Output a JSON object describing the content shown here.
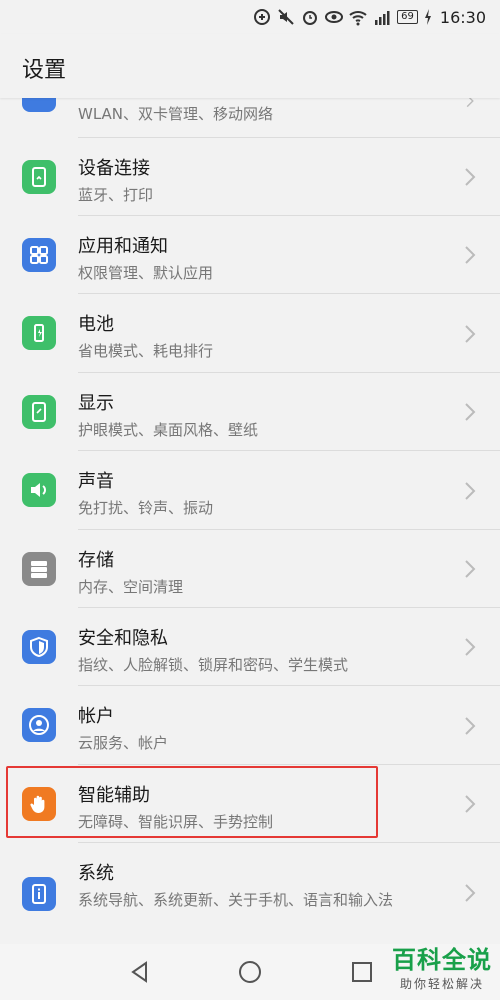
{
  "status_bar": {
    "icons": [
      "data-saver-icon",
      "mute-icon",
      "alarm-icon",
      "eye-comfort-icon",
      "wifi-icon",
      "signal-4g-icon"
    ],
    "battery": "69",
    "time": "16:30"
  },
  "header": {
    "title": "设置"
  },
  "partial_item": {
    "subtitle": "WLAN、双卡管理、移动网络"
  },
  "items": [
    {
      "title": "设备连接",
      "subtitle": "蓝牙、打印",
      "icon": "device-connection-icon",
      "color": "#3fbf6a"
    },
    {
      "title": "应用和通知",
      "subtitle": "权限管理、默认应用",
      "icon": "apps-icon",
      "color": "#3f7be0"
    },
    {
      "title": "电池",
      "subtitle": "省电模式、耗电排行",
      "icon": "battery-icon",
      "color": "#3fbf6a"
    },
    {
      "title": "显示",
      "subtitle": "护眼模式、桌面风格、壁纸",
      "icon": "display-icon",
      "color": "#3fbf6a"
    },
    {
      "title": "声音",
      "subtitle": "免打扰、铃声、振动",
      "icon": "sound-icon",
      "color": "#3fbf6a"
    },
    {
      "title": "存储",
      "subtitle": "内存、空间清理",
      "icon": "storage-icon",
      "color": "#8a8a8a"
    },
    {
      "title": "安全和隐私",
      "subtitle": "指纹、人脸解锁、锁屏和密码、学生模式",
      "icon": "shield-icon",
      "color": "#3f7be0"
    },
    {
      "title": "帐户",
      "subtitle": "云服务、帐户",
      "icon": "account-icon",
      "color": "#3f7be0"
    },
    {
      "title": "智能辅助",
      "subtitle": "无障碍、智能识屏、手势控制",
      "icon": "hand-icon",
      "color": "#f07a22"
    },
    {
      "title": "系统",
      "subtitle": "系统导航、系统更新、关于手机、语言和输入法",
      "icon": "system-info-icon",
      "color": "#3f7be0"
    }
  ],
  "watermark": {
    "main": "百科全说",
    "sub": "助你轻松解决"
  },
  "colors": {
    "highlight": "#e53935",
    "watermark": "#19a04a"
  }
}
